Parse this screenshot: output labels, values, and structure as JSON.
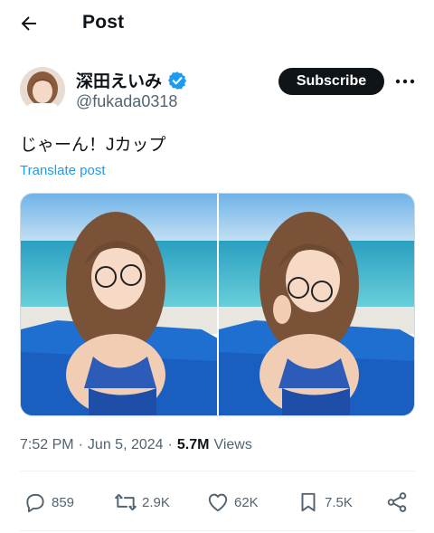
{
  "header": {
    "title": "Post",
    "back_icon": "arrow-left-icon"
  },
  "author": {
    "display_name": "深田えいみ",
    "handle": "@fukada0318",
    "verified": true,
    "verified_color": "#1d9bf0",
    "avatar_icon": "profile-avatar"
  },
  "subscribe_label": "Subscribe",
  "more_icon": "more-horizontal-icon",
  "post": {
    "text": "じゃーん！Jカップ",
    "translate_label": "Translate post",
    "media": [
      {
        "name": "photo-1"
      },
      {
        "name": "photo-2"
      }
    ],
    "time": "7:52 PM",
    "date": "Jun 5, 2024",
    "views_count": "5.7M",
    "views_label": "Views"
  },
  "actions": {
    "replies": "859",
    "reposts": "2.9K",
    "likes": "62K",
    "bookmarks": "7.5K"
  },
  "colors": {
    "link": "#1d9bf0",
    "text": "#0f1419",
    "muted": "#536471",
    "button_bg": "#0f1419"
  }
}
